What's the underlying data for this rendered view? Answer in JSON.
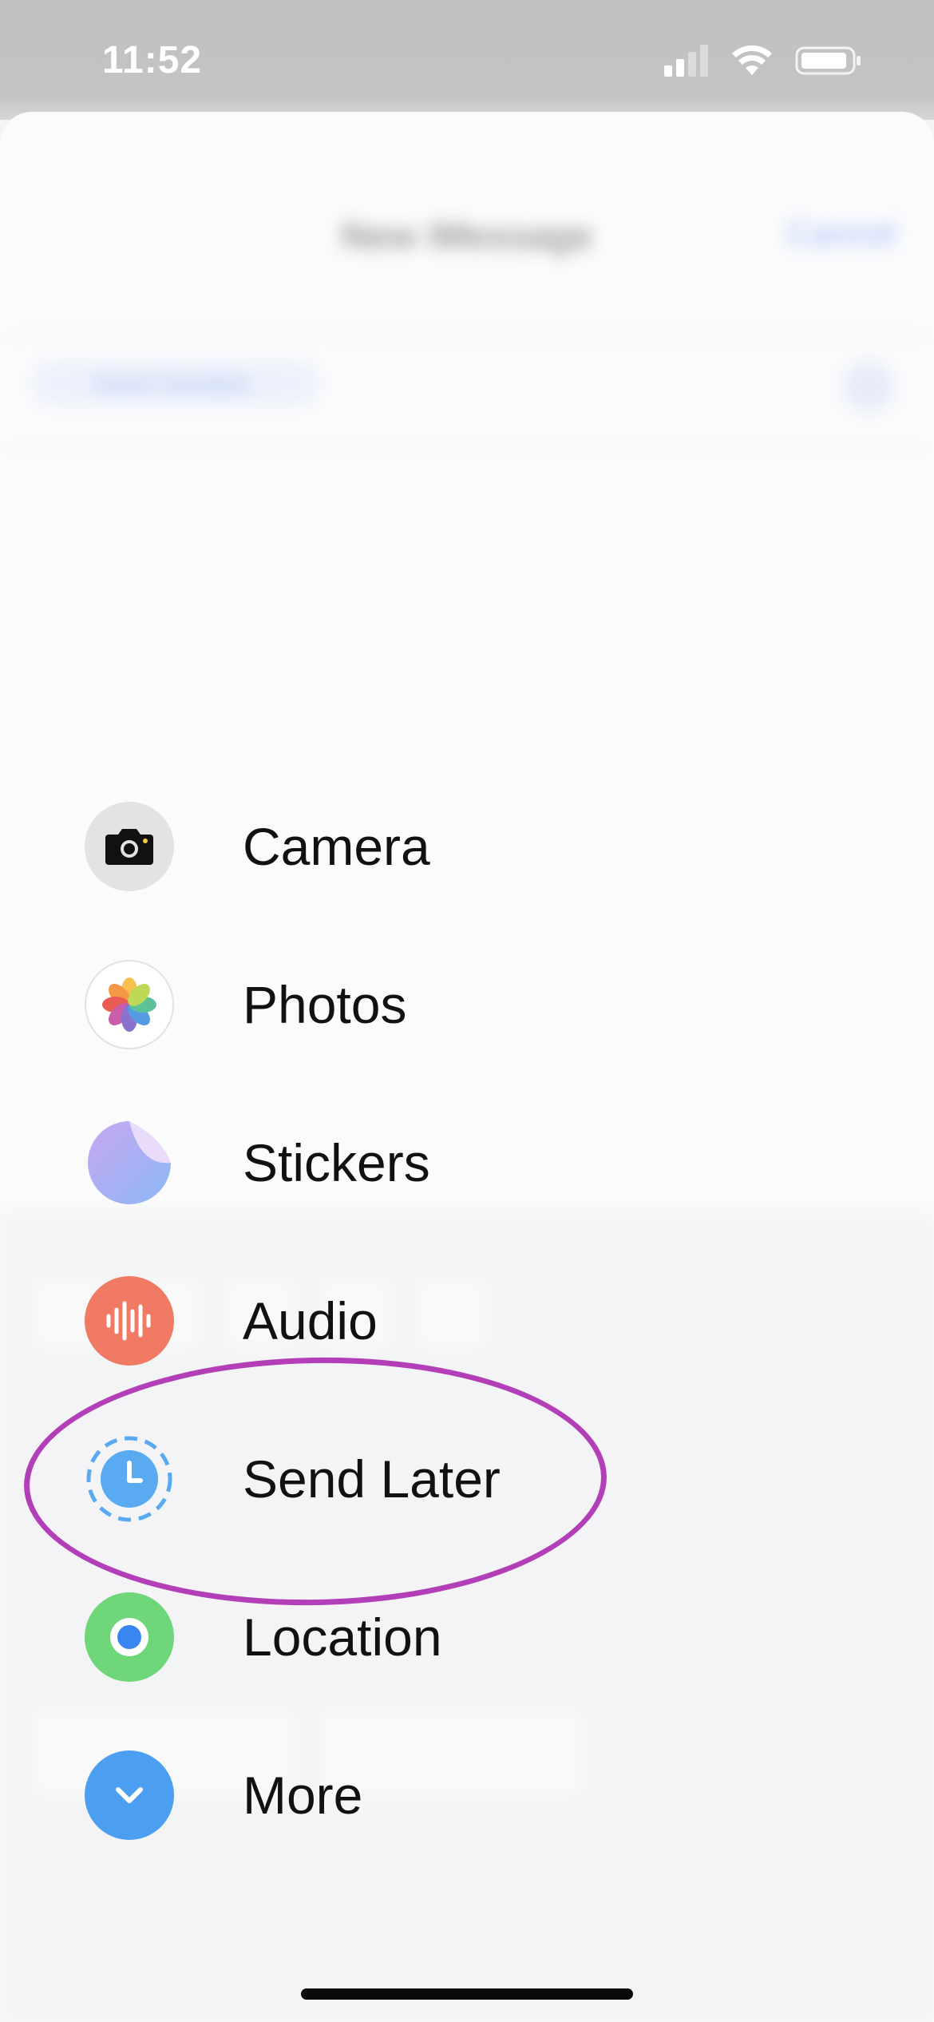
{
  "status_bar": {
    "time": "11:52",
    "icons": [
      "signal-icon",
      "wifi-icon",
      "battery-icon"
    ]
  },
  "background": {
    "title": "New iMessage",
    "cancel_label": "Cancel",
    "recipient_label": "Kent Gordon"
  },
  "menu": {
    "items": [
      {
        "label": "Camera",
        "icon": "camera-icon"
      },
      {
        "label": "Photos",
        "icon": "photos-icon"
      },
      {
        "label": "Stickers",
        "icon": "stickers-icon"
      },
      {
        "label": "Audio",
        "icon": "audio-waveform-icon"
      },
      {
        "label": "Send Later",
        "icon": "clock-icon"
      },
      {
        "label": "Location",
        "icon": "location-icon"
      },
      {
        "label": "More",
        "icon": "chevron-down-icon"
      }
    ]
  },
  "annotation": {
    "highlighted_item": "Send Later",
    "color": "#b23fb8"
  },
  "colors": {
    "audio": "#f07a63",
    "send_later": "#5aaaf2",
    "location": "#6fd67a",
    "more": "#4c9ff0"
  }
}
